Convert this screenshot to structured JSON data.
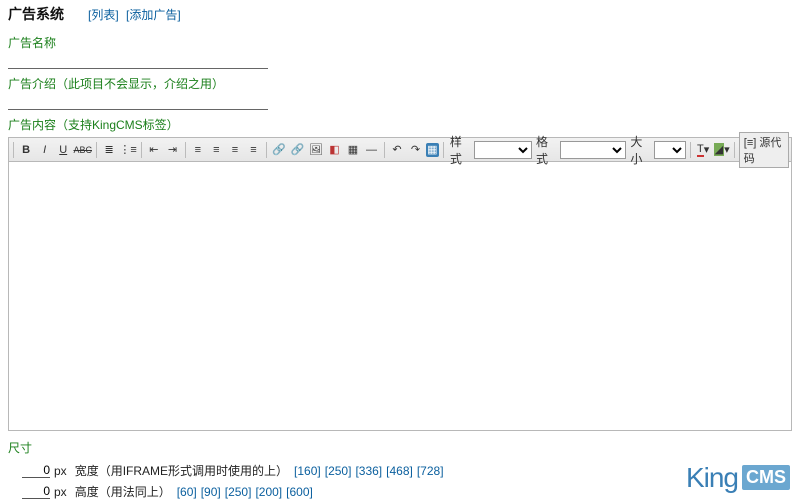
{
  "header": {
    "title": "广告系统",
    "list_link": "[列表]",
    "add_link": "[添加广告]"
  },
  "fields": {
    "name_label": "广告名称",
    "intro_label": "广告介绍（此项目不会显示，介绍之用）",
    "content_label": "广告内容（支持KingCMS标签）"
  },
  "toolbar": {
    "bold": "B",
    "italic": "I",
    "underline": "U",
    "strike": "ABC",
    "style_label": "样式",
    "format_label": "格式",
    "size_label": "大小",
    "source_label": "[≡] 源代码"
  },
  "size": {
    "section_label": "尺寸",
    "width_value": "0",
    "width_unit": "px",
    "width_desc": "宽度（用IFRAME形式调用时使用的上）",
    "width_presets": [
      "160",
      "250",
      "336",
      "468",
      "728"
    ],
    "height_value": "0",
    "height_unit": "px",
    "height_desc": "高度（用法同上）",
    "height_presets": [
      "60",
      "90",
      "250",
      "200",
      "600"
    ]
  },
  "brand": {
    "king": "King",
    "cms": "CMS"
  }
}
